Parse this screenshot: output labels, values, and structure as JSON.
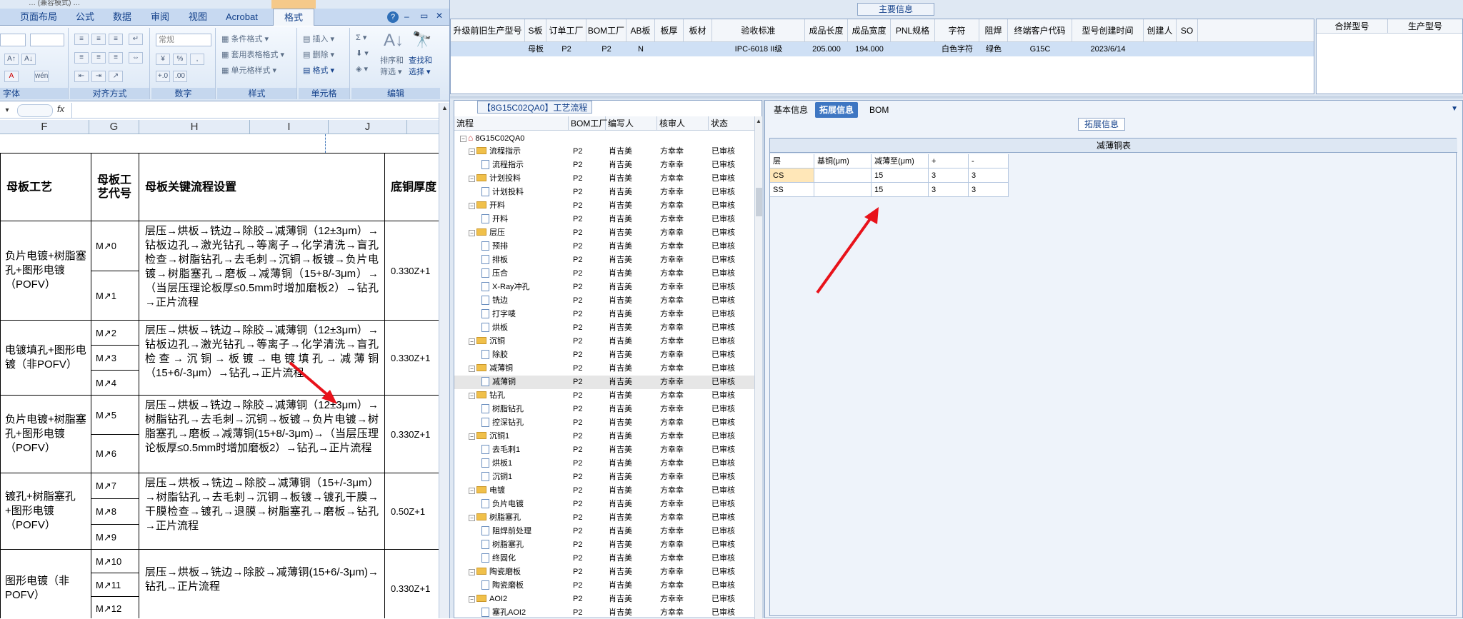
{
  "excel": {
    "title_fragment": "… (兼容模式) …",
    "tabs": [
      "页面布局",
      "公式",
      "数据",
      "审阅",
      "视图",
      "Acrobat",
      "格式"
    ],
    "help_icons": [
      "?",
      "–",
      "▭",
      "✕"
    ],
    "ribbon": {
      "font_group_label": "字体",
      "font_buttons": [
        "A↑",
        "A↓",
        "A",
        "wén"
      ],
      "align_group_label": "对齐方式",
      "number_group_label": "数字",
      "number_format_value": "常规",
      "number_buttons": [
        "%",
        ",",
        "+.0",
        ".00"
      ],
      "style_group_label": "样式",
      "style_buttons": [
        "条件格式 ▾",
        "套用表格格式 ▾",
        "单元格样式 ▾"
      ],
      "cells_group_label": "单元格",
      "cells_buttons": [
        "插入 ▾",
        "删除 ▾",
        "格式 ▾"
      ],
      "edit_group_label": "编辑",
      "edit_buttons": [
        "Σ ▾",
        "排序和",
        "筛选 ▾",
        "查找和",
        "选择 ▾"
      ]
    },
    "formula_bar": {
      "fx": "fx",
      "value": ""
    },
    "columns": [
      "F",
      "G",
      "H",
      "I",
      "J"
    ],
    "headers": {
      "process": "母板工艺",
      "code": "母板工艺代号",
      "key_flow": "母板关键流程设置",
      "thickness": "底铜厚度"
    },
    "groups": [
      {
        "name": "负片电镀+树脂塞孔+图形电镀（POFV）",
        "codes": [
          "M↗0",
          "M↗1"
        ],
        "flow": "层压→烘板→铣边→除胶→减薄铜（12±3μm）→钻板边孔→激光钻孔→等离子→化学清洗→盲孔检查→树脂钻孔→去毛刺→沉铜→板镀→负片电镀→树脂塞孔→磨板→减薄铜（15+8/-3μm）→（当层压理论板厚≤0.5mm时增加磨板2）→钻孔→正片流程",
        "thickness": "0.330Z+1"
      },
      {
        "name": "电镀填孔+图形电镀（非POFV）",
        "codes": [
          "M↗2",
          "M↗3",
          "M↗4"
        ],
        "flow": "层压→烘板→铣边→除胶→减薄铜（12±3μm）→钻板边孔→激光钻孔→等离子→化学清洗→盲孔检查→沉铜→板镀→电镀填孔→减薄铜（15+6/-3μm）→钻孔→正片流程",
        "thickness": "0.330Z+1"
      },
      {
        "name": "负片电镀+树脂塞孔+图形电镀（POFV）",
        "codes": [
          "M↗5",
          "M↗6"
        ],
        "flow": "层压→烘板→铣边→除胶→减薄铜（12±3μm）→树脂钻孔→去毛刺→沉铜→板镀→负片电镀→树脂塞孔→磨板→减薄铜(15+8/-3μm)→（当层压理论板厚≤0.5mm时增加磨板2）→钻孔→正片流程",
        "thickness": "0.330Z+1"
      },
      {
        "name": "镀孔+树脂塞孔+图形电镀（POFV）",
        "codes": [
          "M↗7",
          "M↗8",
          "M↗9"
        ],
        "flow": "层压→烘板→铣边→除胶→减薄铜（15+/-3μm）→树脂钻孔→去毛刺→沉铜→板镀→镀孔干膜→干膜检查→镀孔→退膜→树脂塞孔→磨板→钻孔→正片流程",
        "thickness": "0.50Z+1"
      },
      {
        "name": "图形电镀（非POFV）",
        "codes": [
          "M↗10",
          "M↗11",
          "M↗12"
        ],
        "flow": "层压→烘板→铣边→除胶→减薄铜(15+6/-3μm)→钻孔→正片流程",
        "thickness": "0.330Z+1"
      }
    ]
  },
  "erp": {
    "main_title": "主要信息",
    "main_columns": [
      "升级前旧生产型号",
      "S板",
      "订单工厂",
      "BOM工厂",
      "AB板",
      "板厚",
      "板材",
      "验收标准",
      "成品长度",
      "成品宽度",
      "PNL规格",
      "字符",
      "阻焊",
      "终端客户代码",
      "型号创建时间",
      "创建人",
      "SO"
    ],
    "main_row": [
      "",
      "母板",
      "P2",
      "P2",
      "N",
      "",
      "",
      "IPC-6018 II级",
      "205.000",
      "194.000",
      "",
      "白色字符",
      "绿色",
      "G15C",
      "2023/6/14",
      "",
      ""
    ],
    "side_columns": [
      "合拼型号",
      "生产型号"
    ],
    "process_title": "【8G15C02QA0】工艺流程",
    "process_columns": [
      "流程",
      "BOM工厂",
      "编写人",
      "核审人",
      "状态"
    ],
    "process_root": "8G15C02QA0",
    "process_rows": [
      {
        "level": 1,
        "type": "folder",
        "label": "流程指示",
        "bom": "P2",
        "writer": "肖吉美",
        "reviewer": "方幸幸",
        "status": "已审核"
      },
      {
        "level": 2,
        "type": "doc",
        "label": "流程指示",
        "bom": "P2",
        "writer": "肖吉美",
        "reviewer": "方幸幸",
        "status": "已审核"
      },
      {
        "level": 1,
        "type": "folder",
        "label": "计划投料",
        "bom": "P2",
        "writer": "肖吉美",
        "reviewer": "方幸幸",
        "status": "已审核"
      },
      {
        "level": 2,
        "type": "doc",
        "label": "计划投料",
        "bom": "P2",
        "writer": "肖吉美",
        "reviewer": "方幸幸",
        "status": "已审核"
      },
      {
        "level": 1,
        "type": "folder",
        "label": "开料",
        "bom": "P2",
        "writer": "肖吉美",
        "reviewer": "方幸幸",
        "status": "已审核"
      },
      {
        "level": 2,
        "type": "doc",
        "label": "开料",
        "bom": "P2",
        "writer": "肖吉美",
        "reviewer": "方幸幸",
        "status": "已审核"
      },
      {
        "level": 1,
        "type": "folder",
        "label": "层压",
        "bom": "P2",
        "writer": "肖吉美",
        "reviewer": "方幸幸",
        "status": "已审核"
      },
      {
        "level": 2,
        "type": "doc",
        "label": "预排",
        "bom": "P2",
        "writer": "肖吉美",
        "reviewer": "方幸幸",
        "status": "已审核"
      },
      {
        "level": 2,
        "type": "doc",
        "label": "排板",
        "bom": "P2",
        "writer": "肖吉美",
        "reviewer": "方幸幸",
        "status": "已审核"
      },
      {
        "level": 2,
        "type": "doc",
        "label": "压合",
        "bom": "P2",
        "writer": "肖吉美",
        "reviewer": "方幸幸",
        "status": "已审核"
      },
      {
        "level": 2,
        "type": "doc",
        "label": "X-Ray冲孔",
        "bom": "P2",
        "writer": "肖吉美",
        "reviewer": "方幸幸",
        "status": "已审核"
      },
      {
        "level": 2,
        "type": "doc",
        "label": "铣边",
        "bom": "P2",
        "writer": "肖吉美",
        "reviewer": "方幸幸",
        "status": "已审核"
      },
      {
        "level": 2,
        "type": "doc",
        "label": "打字唛",
        "bom": "P2",
        "writer": "肖吉美",
        "reviewer": "方幸幸",
        "status": "已审核"
      },
      {
        "level": 2,
        "type": "doc",
        "label": "烘板",
        "bom": "P2",
        "writer": "肖吉美",
        "reviewer": "方幸幸",
        "status": "已审核"
      },
      {
        "level": 1,
        "type": "folder",
        "label": "沉铜",
        "bom": "P2",
        "writer": "肖吉美",
        "reviewer": "方幸幸",
        "status": "已审核"
      },
      {
        "level": 2,
        "type": "doc",
        "label": "除胶",
        "bom": "P2",
        "writer": "肖吉美",
        "reviewer": "方幸幸",
        "status": "已审核"
      },
      {
        "level": 1,
        "type": "folder",
        "label": "减薄铜",
        "bom": "P2",
        "writer": "肖吉美",
        "reviewer": "方幸幸",
        "status": "已审核"
      },
      {
        "level": 2,
        "type": "doc",
        "label": "减薄铜",
        "bom": "P2",
        "writer": "肖吉美",
        "reviewer": "方幸幸",
        "status": "已审核",
        "selected": true
      },
      {
        "level": 1,
        "type": "folder",
        "label": "钻孔",
        "bom": "P2",
        "writer": "肖吉美",
        "reviewer": "方幸幸",
        "status": "已审核"
      },
      {
        "level": 2,
        "type": "doc",
        "label": "树脂钻孔",
        "bom": "P2",
        "writer": "肖吉美",
        "reviewer": "方幸幸",
        "status": "已审核"
      },
      {
        "level": 2,
        "type": "doc",
        "label": "控深钻孔",
        "bom": "P2",
        "writer": "肖吉美",
        "reviewer": "方幸幸",
        "status": "已审核"
      },
      {
        "level": 1,
        "type": "folder",
        "label": "沉铜1",
        "bom": "P2",
        "writer": "肖吉美",
        "reviewer": "方幸幸",
        "status": "已审核"
      },
      {
        "level": 2,
        "type": "doc",
        "label": "去毛刺1",
        "bom": "P2",
        "writer": "肖吉美",
        "reviewer": "方幸幸",
        "status": "已审核"
      },
      {
        "level": 2,
        "type": "doc",
        "label": "烘板1",
        "bom": "P2",
        "writer": "肖吉美",
        "reviewer": "方幸幸",
        "status": "已审核"
      },
      {
        "level": 2,
        "type": "doc",
        "label": "沉铜1",
        "bom": "P2",
        "writer": "肖吉美",
        "reviewer": "方幸幸",
        "status": "已审核"
      },
      {
        "level": 1,
        "type": "folder",
        "label": "电镀",
        "bom": "P2",
        "writer": "肖吉美",
        "reviewer": "方幸幸",
        "status": "已审核"
      },
      {
        "level": 2,
        "type": "doc",
        "label": "负片电镀",
        "bom": "P2",
        "writer": "肖吉美",
        "reviewer": "方幸幸",
        "status": "已审核"
      },
      {
        "level": 1,
        "type": "folder",
        "label": "树脂塞孔",
        "bom": "P2",
        "writer": "肖吉美",
        "reviewer": "方幸幸",
        "status": "已审核"
      },
      {
        "level": 2,
        "type": "doc",
        "label": "阻焊前处理",
        "bom": "P2",
        "writer": "肖吉美",
        "reviewer": "方幸幸",
        "status": "已审核"
      },
      {
        "level": 2,
        "type": "doc",
        "label": "树脂塞孔",
        "bom": "P2",
        "writer": "肖吉美",
        "reviewer": "方幸幸",
        "status": "已审核"
      },
      {
        "level": 2,
        "type": "doc",
        "label": "终固化",
        "bom": "P2",
        "writer": "肖吉美",
        "reviewer": "方幸幸",
        "status": "已审核"
      },
      {
        "level": 1,
        "type": "folder",
        "label": "陶瓷磨板",
        "bom": "P2",
        "writer": "肖吉美",
        "reviewer": "方幸幸",
        "status": "已审核"
      },
      {
        "level": 2,
        "type": "doc",
        "label": "陶瓷磨板",
        "bom": "P2",
        "writer": "肖吉美",
        "reviewer": "方幸幸",
        "status": "已审核"
      },
      {
        "level": 1,
        "type": "folder",
        "label": "AOI2",
        "bom": "P2",
        "writer": "肖吉美",
        "reviewer": "方幸幸",
        "status": "已审核"
      },
      {
        "level": 2,
        "type": "doc",
        "label": "塞孔AOI2",
        "bom": "P2",
        "writer": "肖吉美",
        "reviewer": "方幸幸",
        "status": "已审核"
      }
    ],
    "detail_tabs": [
      "基本信息",
      "拓展信息",
      "BOM"
    ],
    "active_detail_tab": "拓展信息",
    "ext_title": "拓展信息",
    "thin_copy": {
      "title": "减薄铜表",
      "columns": [
        "层",
        "基铜(μm)",
        "减薄至(μm)",
        "+",
        "-"
      ],
      "rows": [
        [
          "CS",
          "",
          "15",
          "3",
          "3"
        ],
        [
          "SS",
          "",
          "15",
          "3",
          "3"
        ]
      ]
    }
  },
  "annotations": {
    "arrow_color": "#e8121a"
  }
}
